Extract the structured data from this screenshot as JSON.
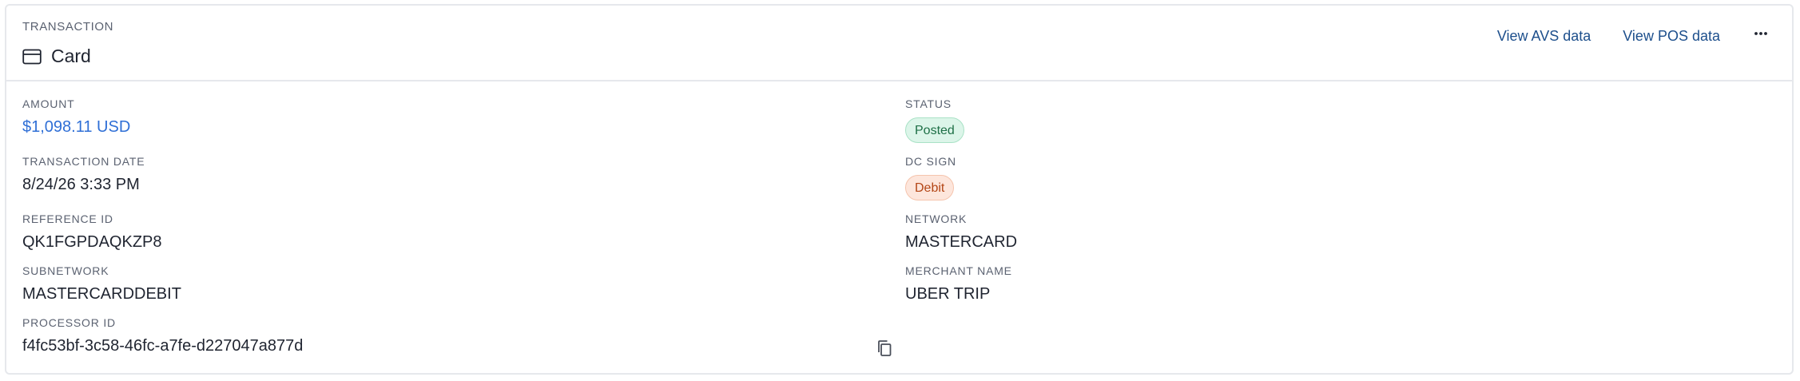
{
  "header": {
    "eyebrow": "TRANSACTION",
    "title": "Card",
    "actions": {
      "view_avs": "View AVS data",
      "view_pos": "View POS data"
    }
  },
  "fields": {
    "amount": {
      "label": "AMOUNT",
      "value": "$1,098.11 USD"
    },
    "status": {
      "label": "STATUS",
      "value": "Posted"
    },
    "transaction_date": {
      "label": "TRANSACTION DATE",
      "value": "8/24/26 3:33 PM"
    },
    "dc_sign": {
      "label": "DC SIGN",
      "value": "Debit"
    },
    "reference_id": {
      "label": "REFERENCE ID",
      "value": "QK1FGPDAQKZP8"
    },
    "network": {
      "label": "NETWORK",
      "value": "MASTERCARD"
    },
    "subnetwork": {
      "label": "SUBNETWORK",
      "value": "MASTERCARDDEBIT"
    },
    "merchant_name": {
      "label": "MERCHANT NAME",
      "value": "UBER TRIP"
    },
    "processor_id": {
      "label": "PROCESSOR ID",
      "value": "f4fc53bf-3c58-46fc-a7fe-d227047a877d"
    }
  },
  "icons": {
    "card": "credit-card-icon",
    "more": "more-horizontal-icon",
    "copy": "copy-icon"
  },
  "colors": {
    "link": "#1d4f8c",
    "amount": "#2f6fd6",
    "posted_bg": "#dcf5e9",
    "posted_text": "#1e6f46",
    "debit_bg": "#fde6dc",
    "debit_text": "#b34515"
  }
}
